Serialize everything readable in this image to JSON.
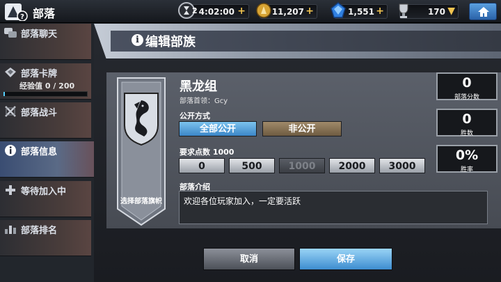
{
  "header": {
    "title": "部落",
    "hourglass_count": "2",
    "time": "4:02:00",
    "gold": "11,207",
    "gems": "1,551",
    "trophies": "170",
    "time_plus": "+",
    "gold_plus": "+",
    "gem_plus": "+",
    "trophy_arrow": "▼",
    "icons": [
      "clan-logo-icon",
      "hourglass-icon",
      "gold-coin-icon",
      "gem-icon",
      "trophy-icon",
      "home-icon"
    ]
  },
  "sidebar": {
    "items": [
      {
        "label": "部落聊天",
        "icon": "chat-icon"
      },
      {
        "label": "部落卡牌",
        "icon": "cards-icon",
        "exp_label": "经验值 0 / 200",
        "exp_progress": 0
      },
      {
        "label": "部落战斗",
        "icon": "crossed-swords-icon"
      },
      {
        "label": "部落信息",
        "icon": "info-icon",
        "active": true
      },
      {
        "label": "等待加入中",
        "icon": "plus-icon"
      },
      {
        "label": "部落排名",
        "icon": "ranking-icon"
      }
    ]
  },
  "main": {
    "title": "编辑部族",
    "title_icon": "i",
    "banner_label": "选择部落旗帜",
    "clan_name": "黑龙组",
    "leader": "部落首领：Gcy",
    "publicity_label": "公开方式",
    "publicity_options": [
      "全部公开",
      "非公开"
    ],
    "selected_publicity": "全部公开",
    "requirement_label": "要求点数 1000",
    "requirement_options": [
      "0",
      "500",
      "1000",
      "2000",
      "3000"
    ],
    "selected_requirement": "1000",
    "intro_label": "部落介绍",
    "intro_text": "欢迎各位玩家加入，一定要活跃",
    "stats": [
      {
        "value": "0",
        "caption": "部落分数"
      },
      {
        "value": "0",
        "caption": "胜数"
      },
      {
        "value": "0%",
        "caption": "胜率"
      }
    ],
    "cancel_label": "取消",
    "save_label": "保存"
  },
  "colors": {
    "accent_blue": "#3b86c8",
    "gold": "#f2c450",
    "panel": "#52565f"
  }
}
